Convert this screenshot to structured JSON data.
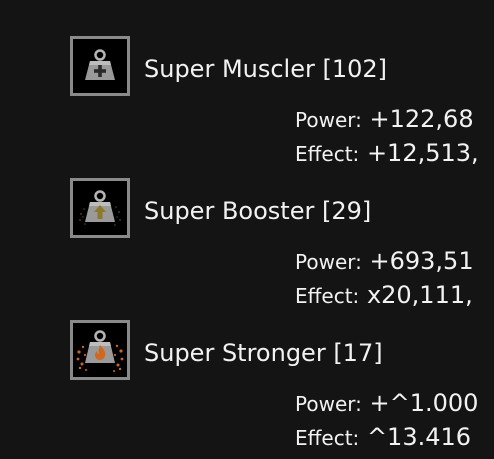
{
  "upgrades": [
    {
      "icon": "weight-plus-icon",
      "name": "Super Muscler [102]",
      "power_label": "Power:",
      "power_value": "+122,68",
      "effect_label": "Effect:",
      "effect_value": "+12,513,"
    },
    {
      "icon": "weight-arrow-up-icon",
      "name": "Super Booster [29]",
      "power_label": "Power:",
      "power_value": "+693,51",
      "effect_label": "Effect:",
      "effect_value": "x20,111,"
    },
    {
      "icon": "weight-flame-icon",
      "name": "Super Stronger [17]",
      "power_label": "Power:",
      "power_value": "+^1.000",
      "effect_label": "Effect:",
      "effect_value": "^13.416"
    }
  ],
  "colors": {
    "background": "#141414",
    "text": "#f2f2f2",
    "icon_border": "#8a8a8a",
    "weight_gray": "#9a9a9a",
    "accent_green": "#9c8a3a",
    "accent_orange": "#c8651e"
  }
}
